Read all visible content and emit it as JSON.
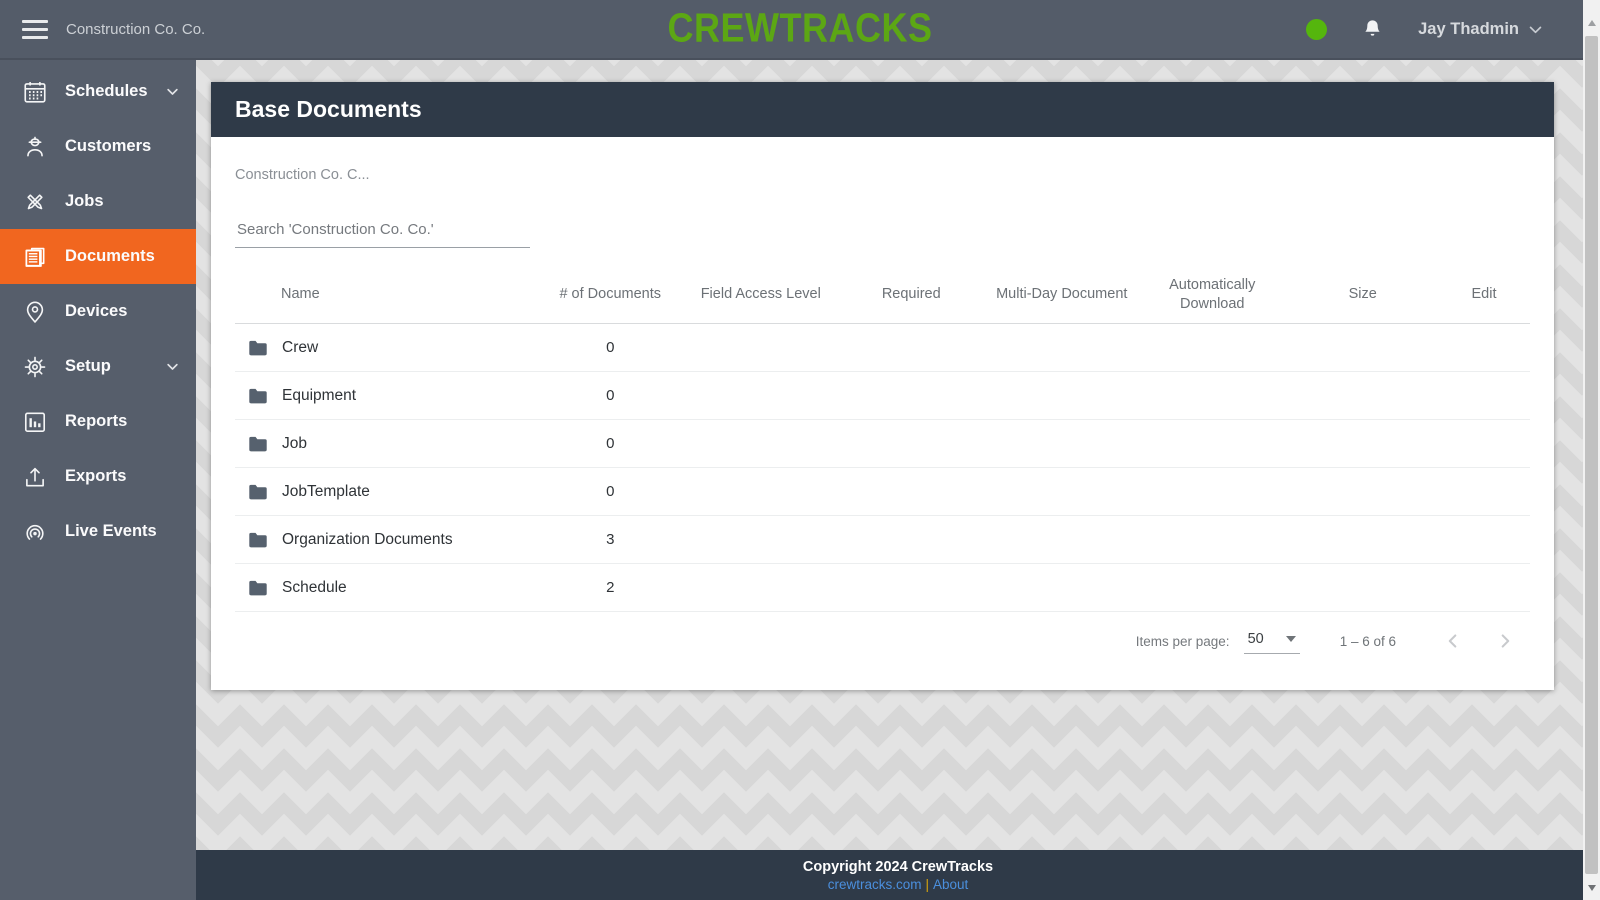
{
  "header": {
    "org_name": "Construction Co. Co.",
    "logo_text": "CREWTRACKS",
    "user_name": "Jay Thadmin"
  },
  "sidebar": {
    "items": [
      {
        "label": "Schedules",
        "icon": "calendar-icon",
        "expandable": true,
        "active": false
      },
      {
        "label": "Customers",
        "icon": "worker-icon",
        "expandable": false,
        "active": false
      },
      {
        "label": "Jobs",
        "icon": "crossed-tools-icon",
        "expandable": false,
        "active": false
      },
      {
        "label": "Documents",
        "icon": "documents-icon",
        "expandable": false,
        "active": true
      },
      {
        "label": "Devices",
        "icon": "map-pin-icon",
        "expandable": false,
        "active": false
      },
      {
        "label": "Setup",
        "icon": "gear-icon",
        "expandable": true,
        "active": false
      },
      {
        "label": "Reports",
        "icon": "bar-chart-icon",
        "expandable": false,
        "active": false
      },
      {
        "label": "Exports",
        "icon": "upload-icon",
        "expandable": false,
        "active": false
      },
      {
        "label": "Live Events",
        "icon": "broadcast-icon",
        "expandable": false,
        "active": false
      }
    ]
  },
  "main": {
    "card_title": "Base Documents",
    "breadcrumb": "Construction Co. C...",
    "search_placeholder": "Search 'Construction Co. Co.'",
    "table": {
      "columns": [
        "Name",
        "# of Documents",
        "Field Access Level",
        "Required",
        "Multi-Day Document",
        "Automatically Download",
        "Size",
        "Edit"
      ],
      "rows": [
        {
          "name": "Crew",
          "count": "0"
        },
        {
          "name": "Equipment",
          "count": "0"
        },
        {
          "name": "Job",
          "count": "0"
        },
        {
          "name": "JobTemplate",
          "count": "0"
        },
        {
          "name": "Organization Documents",
          "count": "3"
        },
        {
          "name": "Schedule",
          "count": "2"
        }
      ]
    },
    "pagination": {
      "items_per_page_label": "Items per page:",
      "items_per_page_value": "50",
      "range_label": "1 – 6 of 6"
    }
  },
  "footer": {
    "copyright": "Copyright 2024 CrewTracks",
    "site_link": "crewtracks.com",
    "separator": "|",
    "about_link": "About"
  },
  "colors": {
    "accent_orange": "#f1661f",
    "brand_green": "#5ca714",
    "header_slate": "#545c69",
    "sidebar_slate": "#565e6b",
    "panel_dark": "#2f3a48",
    "status_green": "#55b60d",
    "link_blue": "#4b8fdd",
    "separator_yellow": "#d9a50b"
  }
}
